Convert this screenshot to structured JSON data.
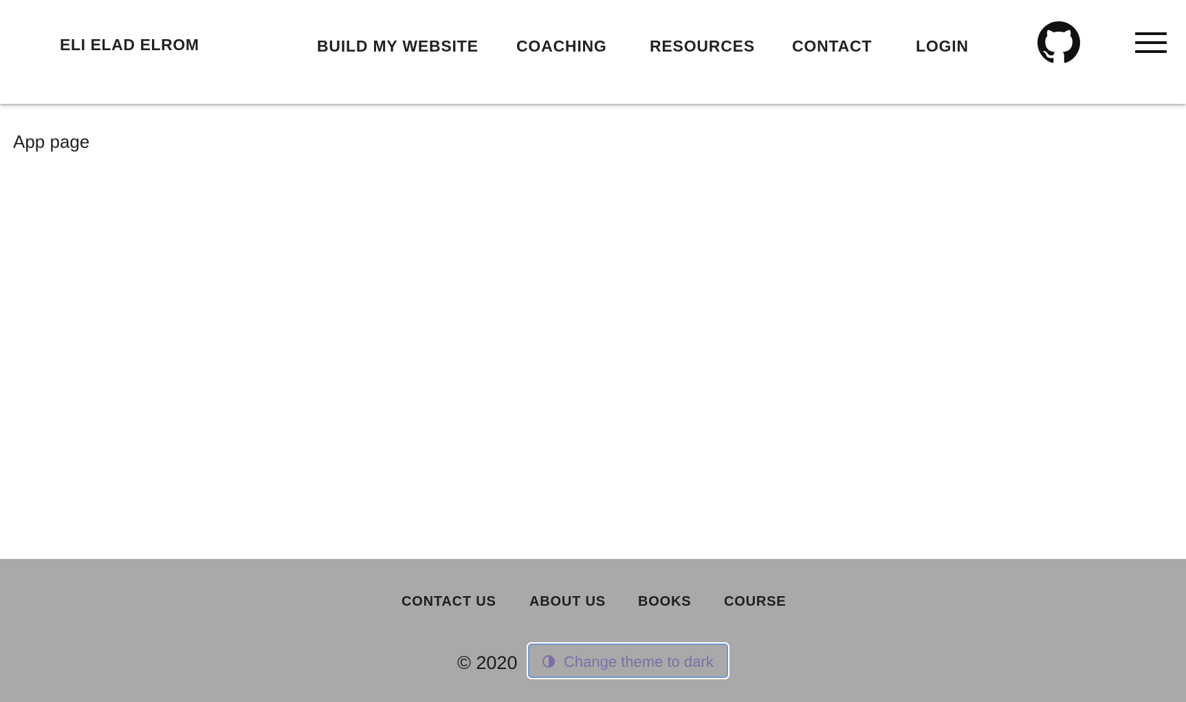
{
  "header": {
    "brand": "ELI ELAD ELROM",
    "nav": [
      "BUILD MY WEBSITE",
      "COACHING",
      "RESOURCES",
      "CONTACT",
      "LOGIN"
    ],
    "github_icon": "github-icon",
    "menu_icon": "hamburger-menu-icon"
  },
  "main": {
    "text": "App page"
  },
  "footer": {
    "links": [
      "CONTACT US",
      "ABOUT US",
      "BOOKS",
      "COURSE"
    ],
    "copyright": "© 2020",
    "theme_button": {
      "label": "Change theme to dark",
      "icon": "contrast-icon",
      "border_color": "#6f96d6",
      "text_color": "#7d6ea8"
    },
    "background": "#a9a9a9"
  }
}
